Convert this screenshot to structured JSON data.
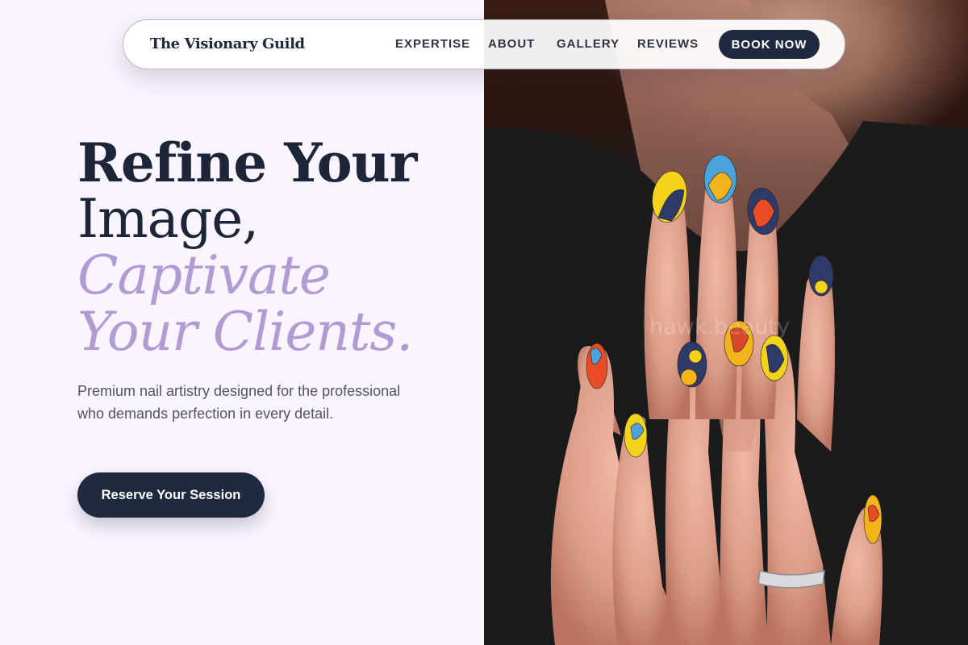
{
  "nav": {
    "brand": "The Visionary Guild",
    "links": [
      "EXPERTISE",
      "ABOUT",
      "GALLERY",
      "REVIEWS"
    ],
    "book_label": "BOOK NOW"
  },
  "hero": {
    "line1": "Refine Your",
    "line2": "Image,",
    "accent1": "Captivate",
    "accent2": "Your Clients.",
    "subtitle": "Premium nail artistry designed for the professional who demands perfection in every detail.",
    "cta_label": "Reserve Your Session"
  },
  "photo": {
    "watermark": "hawk.beauty"
  },
  "colors": {
    "navy": "#1f2940",
    "lavender": "#b19bd5",
    "page_bg": "#f9f4fd"
  }
}
